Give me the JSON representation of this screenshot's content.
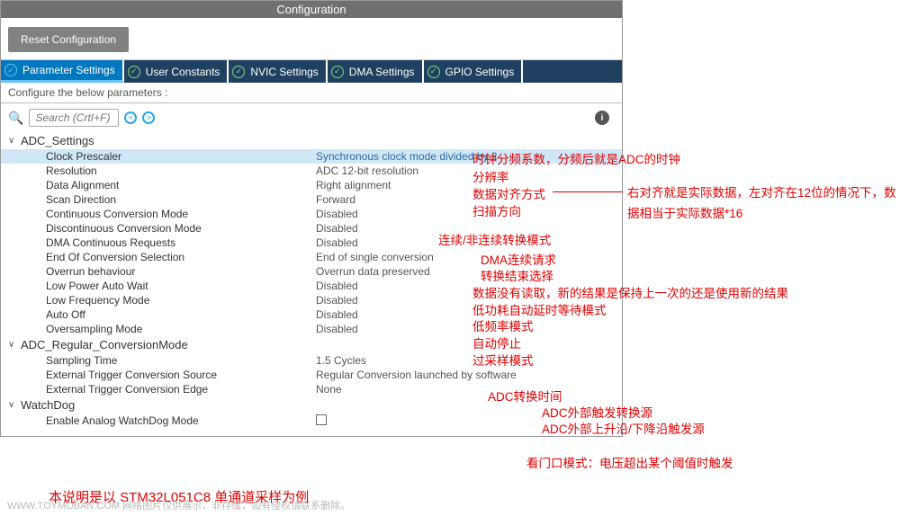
{
  "window": {
    "title": "Configuration",
    "reset_label": "Reset Configuration",
    "subtitle": "Configure the below parameters :"
  },
  "tabs": [
    {
      "label": "Parameter Settings",
      "active": true
    },
    {
      "label": "User Constants",
      "active": false
    },
    {
      "label": "NVIC Settings",
      "active": false
    },
    {
      "label": "DMA Settings",
      "active": false
    },
    {
      "label": "GPIO Settings",
      "active": false
    }
  ],
  "search": {
    "placeholder": "Search (CrtI+F)",
    "prev": "<",
    "next": ">",
    "info": "i"
  },
  "groups": {
    "adc_settings": {
      "header": "ADC_Settings",
      "rows": [
        {
          "label": "Clock Prescaler",
          "value": "Synchronous clock mode divided by 2"
        },
        {
          "label": "Resolution",
          "value": "ADC 12-bit resolution"
        },
        {
          "label": "Data Alignment",
          "value": "Right alignment"
        },
        {
          "label": "Scan Direction",
          "value": "Forward"
        },
        {
          "label": "Continuous Conversion Mode",
          "value": "Disabled"
        },
        {
          "label": "Discontinuous Conversion Mode",
          "value": "Disabled"
        },
        {
          "label": "DMA Continuous Requests",
          "value": "Disabled"
        },
        {
          "label": "End Of Conversion Selection",
          "value": "End of single conversion"
        },
        {
          "label": "Overrun behaviour",
          "value": "Overrun data preserved"
        },
        {
          "label": "Low Power Auto Wait",
          "value": "Disabled"
        },
        {
          "label": "Low Frequency Mode",
          "value": "Disabled"
        },
        {
          "label": "Auto Off",
          "value": "Disabled"
        },
        {
          "label": "Oversampling Mode",
          "value": "Disabled"
        }
      ]
    },
    "adc_regular": {
      "header": "ADC_Regular_ConversionMode",
      "rows": [
        {
          "label": "Sampling Time",
          "value": "1.5 Cycles"
        },
        {
          "label": "External Trigger Conversion Source",
          "value": "Regular Conversion launched by software"
        },
        {
          "label": "External Trigger Conversion Edge",
          "value": "None"
        }
      ]
    },
    "watchdog": {
      "header": "WatchDog",
      "rows": [
        {
          "label": "Enable Analog WatchDog Mode",
          "value": ""
        }
      ]
    }
  },
  "annotations": {
    "a0": "时钟分频系数，分频后就是ADC的时钟",
    "a1": "分辨率",
    "a2": "数据对齐方式",
    "a3": "右对齐就是实际数据，左对齐在12位的情况下，数据相当于实际数据*16",
    "a4": "扫描方向",
    "a5": "连续/非连续转换模式",
    "a6": "DMA连续请求",
    "a7": "转换结束选择",
    "a8": "数据没有读取，新的结果是保持上一次的还是使用新的结果",
    "a9": "低功耗自动延时等待模式",
    "a10": "低频率模式",
    "a11": "自动停止",
    "a12": "过采样模式",
    "a13": "ADC转换时间",
    "a14": "ADC外部触发转换源",
    "a15": "ADC外部上升沿/下降沿触发源",
    "a16": "看门口模式：电压超出某个阈值时触发",
    "a17": "本说明是以 STM32L051C8 单通道采样为例"
  },
  "watermark": "WWW.TOYMOBAN.COM 网络图片仅供展示，非存储，如有侵权请联系删除。"
}
